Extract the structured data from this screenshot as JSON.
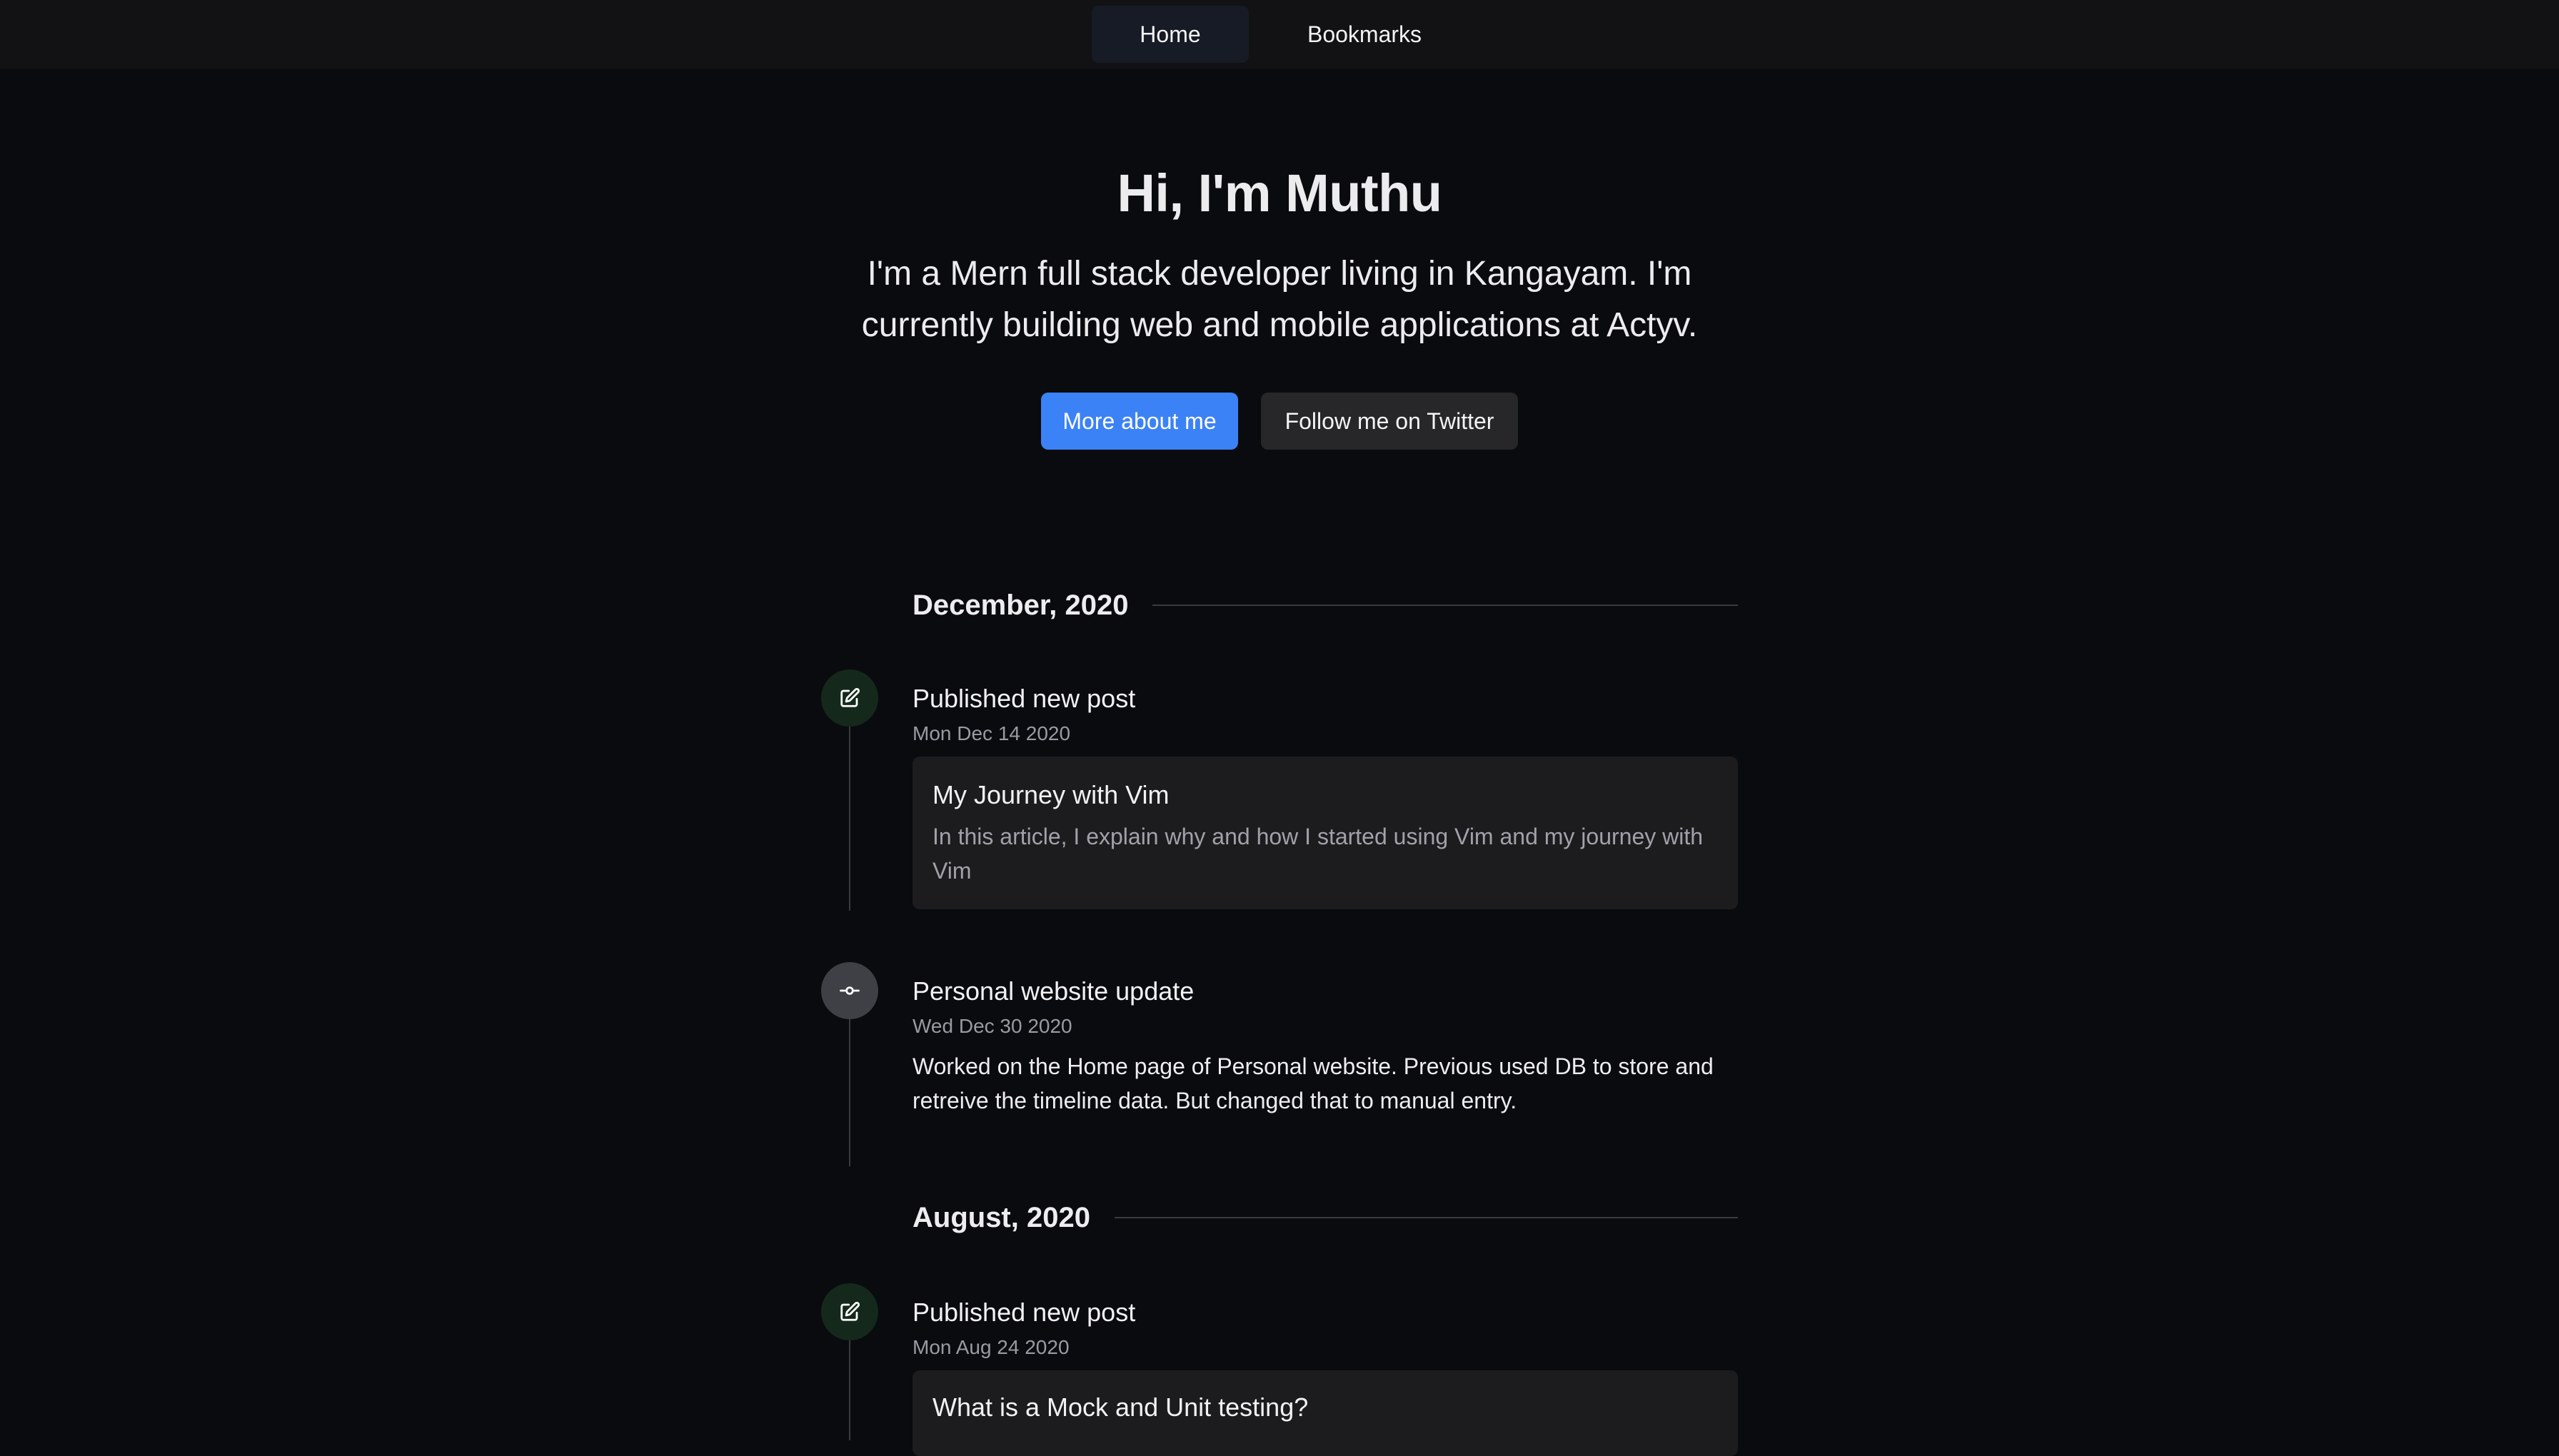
{
  "nav": {
    "items": [
      {
        "label": "Home",
        "active": true
      },
      {
        "label": "Bookmarks",
        "active": false
      }
    ]
  },
  "hero": {
    "title": "Hi, I'm Muthu",
    "subtitle": "I'm a Mern full stack developer living in Kangayam. I'm currently building web and mobile applications at Actyv.",
    "primary_button": "More about me",
    "secondary_button": "Follow me on Twitter"
  },
  "timeline": {
    "months": [
      {
        "label": "December, 2020",
        "events": [
          {
            "icon": "edit-icon",
            "title": "Published new post",
            "date": "Mon Dec 14 2020",
            "post": {
              "title": "My Journey with Vim",
              "description": "In this article, I explain why and how I started using Vim and my journey with Vim"
            }
          },
          {
            "icon": "git-commit-icon",
            "title": "Personal website update",
            "date": "Wed Dec 30 2020",
            "text": "Worked on the Home page of Personal website. Previous used DB to store and retreive the timeline data. But changed that to manual entry."
          }
        ]
      },
      {
        "label": "August, 2020",
        "events": [
          {
            "icon": "edit-icon",
            "title": "Published new post",
            "date": "Mon Aug 24 2020",
            "post": {
              "title": "What is a Mock and Unit testing?",
              "description": ""
            }
          }
        ]
      }
    ]
  },
  "colors": {
    "background": "#0a0b0f",
    "nav_background": "#121214",
    "accent": "#3b82f6",
    "card": "#1c1c1f",
    "post_icon_bg": "#14291b",
    "commit_icon_bg": "#3f3f46"
  }
}
